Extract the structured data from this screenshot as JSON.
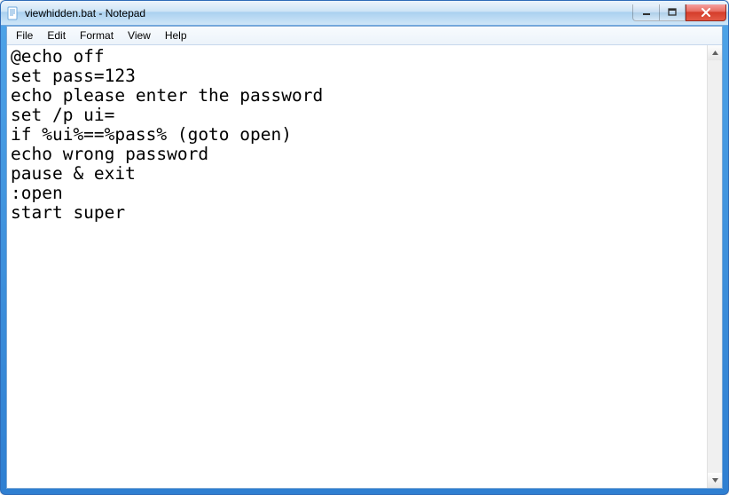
{
  "window": {
    "title": "viewhidden.bat - Notepad"
  },
  "menubar": {
    "items": [
      "File",
      "Edit",
      "Format",
      "View",
      "Help"
    ]
  },
  "editor": {
    "content": "@echo off\nset pass=123\necho please enter the password\nset /p ui=\nif %ui%==%pass% (goto open)\necho wrong password\npause & exit\n:open\nstart super"
  },
  "icons": {
    "app": "notepad-icon",
    "minimize": "minimize-icon",
    "maximize": "maximize-icon",
    "close": "close-icon",
    "scroll_up": "scroll-up-icon",
    "scroll_down": "scroll-down-icon"
  }
}
